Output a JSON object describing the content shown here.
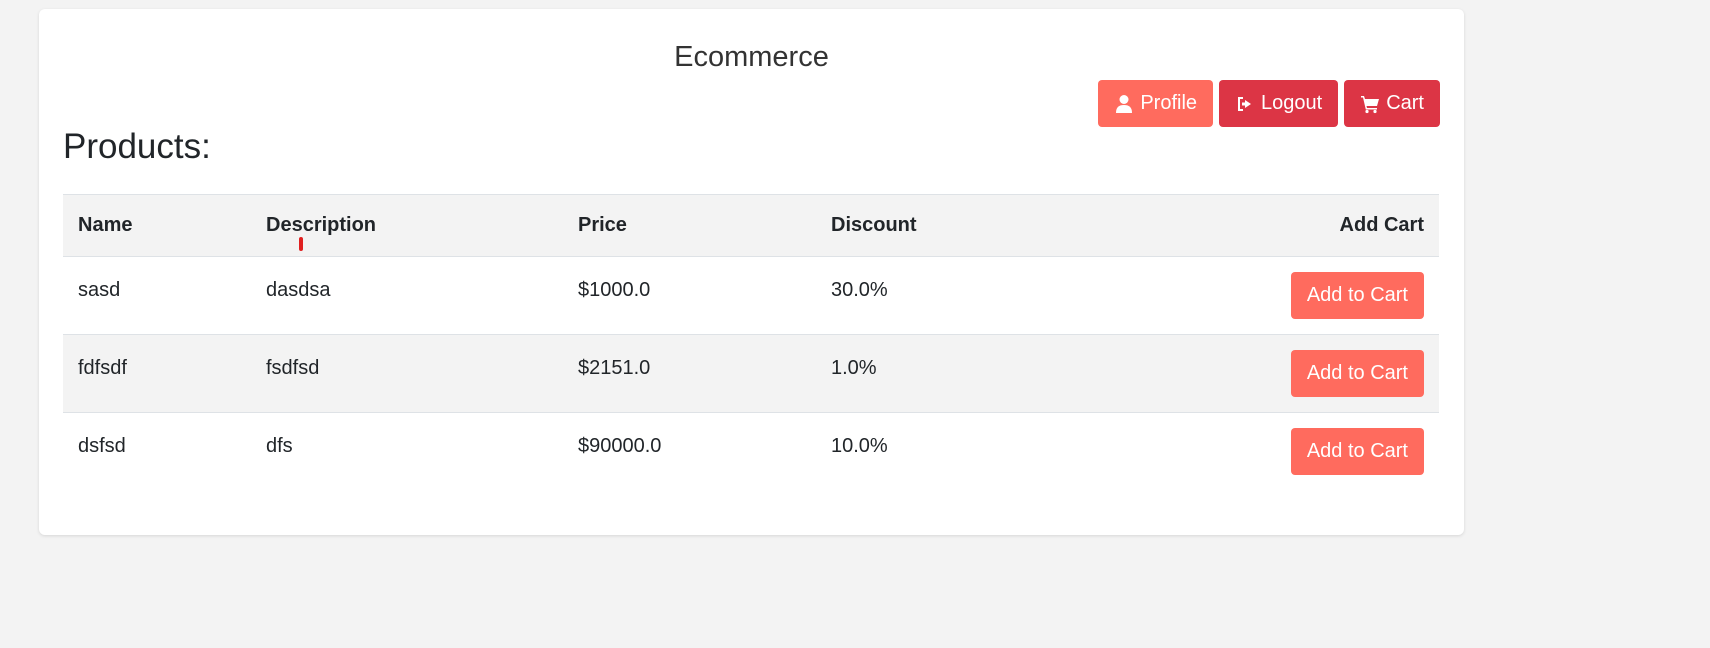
{
  "header": {
    "title": "Ecommerce",
    "buttons": {
      "profile": "Profile",
      "logout": "Logout",
      "cart": "Cart"
    }
  },
  "main": {
    "heading": "Products:",
    "table": {
      "columns": [
        "Name",
        "Description",
        "Price",
        "Discount",
        "Add Cart"
      ],
      "rows": [
        {
          "name": "sasd",
          "description": "dasdsa",
          "price": "$1000.0",
          "discount": "30.0%",
          "action": "Add to Cart"
        },
        {
          "name": "fdfsdf",
          "description": "fsdfsd",
          "price": "$2151.0",
          "discount": "1.0%",
          "action": "Add to Cart"
        },
        {
          "name": "dsfsd",
          "description": "dfs",
          "price": "$90000.0",
          "discount": "10.0%",
          "action": "Add to Cart"
        }
      ]
    }
  },
  "colors": {
    "salmon": "#ff6b5e",
    "crimson": "#dc3545",
    "page_bg": "#f3f3f3"
  },
  "icons": {
    "profile": "user-icon",
    "logout": "sign-out-icon",
    "cart": "shopping-cart-icon"
  }
}
